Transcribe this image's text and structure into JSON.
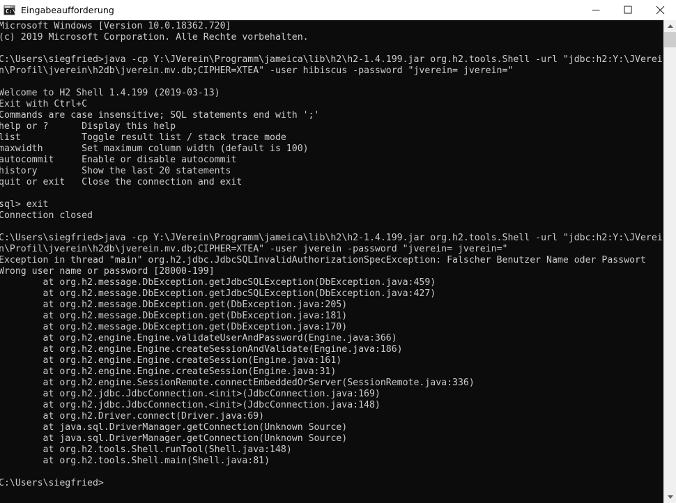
{
  "window": {
    "title": "Eingabeaufforderung",
    "icon": "console-icon",
    "background_color": "#0c0c0c",
    "text_color": "#cccccc",
    "titlebar_background": "#ffffff",
    "titlebar_text_color": "#000000"
  },
  "caption_buttons": {
    "minimize": "minimize-icon",
    "maximize": "maximize-icon",
    "close": "close-icon"
  },
  "scrollbar": {
    "up_arrow": "scroll-up-arrow-icon",
    "down_arrow": "scroll-down-arrow-icon",
    "thumb_color": "#cdcdcd",
    "track_color": "#f0f0f0"
  },
  "console": {
    "lines": [
      "Microsoft Windows [Version 10.0.18362.720]",
      "(c) 2019 Microsoft Corporation. Alle Rechte vorbehalten.",
      "",
      "C:\\Users\\siegfried>java -cp Y:\\JVerein\\Programm\\jameica\\lib\\h2\\h2-1.4.199.jar org.h2.tools.Shell -url \"jdbc:h2:Y:\\JVerei",
      "n\\Profil\\jverein\\h2db\\jverein.mv.db;CIPHER=XTEA\" -user hibiscus -password \"jverein= jverein=\"",
      "",
      "Welcome to H2 Shell 1.4.199 (2019-03-13)",
      "Exit with Ctrl+C",
      "Commands are case insensitive; SQL statements end with ';'",
      "help or ?      Display this help",
      "list           Toggle result list / stack trace mode",
      "maxwidth       Set maximum column width (default is 100)",
      "autocommit     Enable or disable autocommit",
      "history        Show the last 20 statements",
      "quit or exit   Close the connection and exit",
      "",
      "sql> exit",
      "Connection closed",
      "",
      "C:\\Users\\siegfried>java -cp Y:\\JVerein\\Programm\\jameica\\lib\\h2\\h2-1.4.199.jar org.h2.tools.Shell -url \"jdbc:h2:Y:\\JVerei",
      "n\\Profil\\jverein\\h2db\\jverein.mv.db;CIPHER=XTEA\" -user jverein -password \"jverein= jverein=\"",
      "Exception in thread \"main\" org.h2.jdbc.JdbcSQLInvalidAuthorizationSpecException: Falscher Benutzer Name oder Passwort",
      "Wrong user name or password [28000-199]",
      "        at org.h2.message.DbException.getJdbcSQLException(DbException.java:459)",
      "        at org.h2.message.DbException.getJdbcSQLException(DbException.java:427)",
      "        at org.h2.message.DbException.get(DbException.java:205)",
      "        at org.h2.message.DbException.get(DbException.java:181)",
      "        at org.h2.message.DbException.get(DbException.java:170)",
      "        at org.h2.engine.Engine.validateUserAndPassword(Engine.java:366)",
      "        at org.h2.engine.Engine.createSessionAndValidate(Engine.java:186)",
      "        at org.h2.engine.Engine.createSession(Engine.java:161)",
      "        at org.h2.engine.Engine.createSession(Engine.java:31)",
      "        at org.h2.engine.SessionRemote.connectEmbeddedOrServer(SessionRemote.java:336)",
      "        at org.h2.jdbc.JdbcConnection.<init>(JdbcConnection.java:169)",
      "        at org.h2.jdbc.JdbcConnection.<init>(JdbcConnection.java:148)",
      "        at org.h2.Driver.connect(Driver.java:69)",
      "        at java.sql.DriverManager.getConnection(Unknown Source)",
      "        at java.sql.DriverManager.getConnection(Unknown Source)",
      "        at org.h2.tools.Shell.runTool(Shell.java:148)",
      "        at org.h2.tools.Shell.main(Shell.java:81)",
      "",
      "C:\\Users\\siegfried>"
    ]
  }
}
